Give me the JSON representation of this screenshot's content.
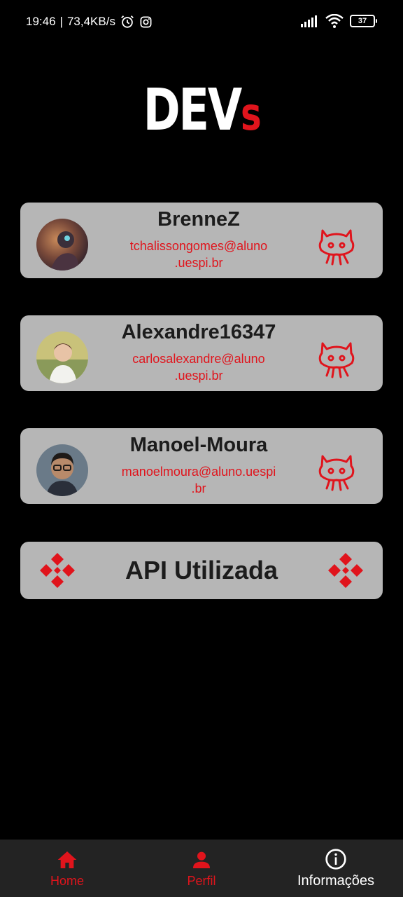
{
  "status_bar": {
    "time": "19:46",
    "network_speed": "73,4KB/s",
    "battery": "37",
    "icons": [
      "alarm-icon",
      "instagram-icon",
      "signal-icon",
      "wifi-icon",
      "battery-icon"
    ]
  },
  "app": {
    "title_main": "DEV",
    "title_accent": "s"
  },
  "developers": [
    {
      "name": "BrenneZ",
      "email_line1": "tchalissongomes@aluno",
      "email_line2": ".uespi.br"
    },
    {
      "name": "Alexandre16347",
      "email_line1": "carlosalexandre@aluno",
      "email_line2": ".uespi.br"
    },
    {
      "name": "Manoel-Moura",
      "email_line1": "manoelmoura@aluno.uespi",
      "email_line2": ".br"
    }
  ],
  "api_card": {
    "label": "API Utilizada"
  },
  "bottom_nav": {
    "items": [
      {
        "label": "Home",
        "icon": "home-icon"
      },
      {
        "label": "Perfil",
        "icon": "person-icon"
      },
      {
        "label": "Informações",
        "icon": "info-icon"
      }
    ]
  },
  "colors": {
    "accent": "#e0141c",
    "card": "#b6b6b6",
    "background": "#000000",
    "nav": "#232323"
  }
}
